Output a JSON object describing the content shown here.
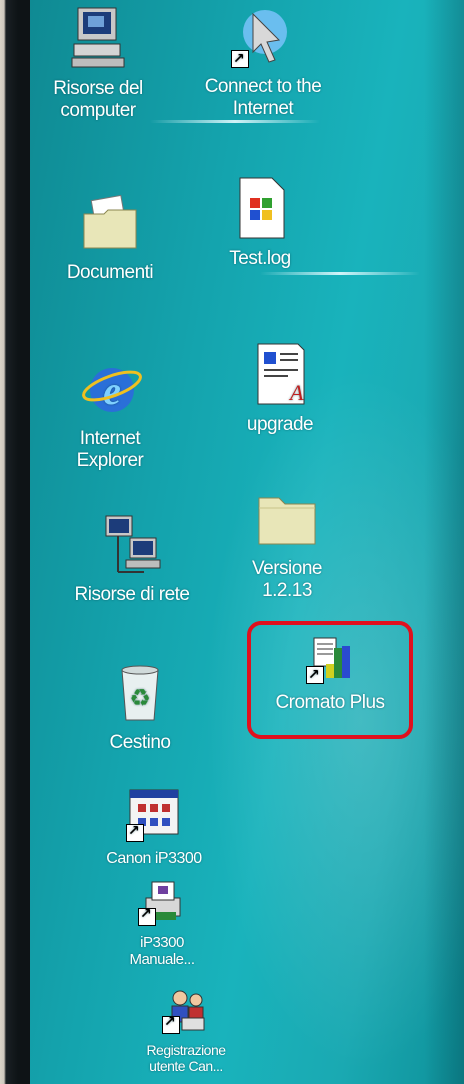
{
  "desktop": {
    "icons": [
      {
        "label": "Risorse del\ncomputer",
        "icon": "my-computer-icon"
      },
      {
        "label": "Connect to the\nInternet",
        "icon": "connect-internet-icon"
      },
      {
        "label": "Documenti",
        "icon": "folder-documents-icon"
      },
      {
        "label": "Test.log",
        "icon": "text-file-icon"
      },
      {
        "label": "Internet\nExplorer",
        "icon": "internet-explorer-icon"
      },
      {
        "label": "upgrade",
        "icon": "wordpad-document-icon"
      },
      {
        "label": "Risorse di rete",
        "icon": "network-icon"
      },
      {
        "label": "Versione\n1.2.13",
        "icon": "folder-icon"
      },
      {
        "label": "Cromato Plus",
        "icon": "cromato-plus-icon"
      },
      {
        "label": "Cestino",
        "icon": "recycle-bin-icon"
      },
      {
        "label": "Canon iP3300",
        "icon": "canon-printer-icon"
      },
      {
        "label": "iP3300\nManuale...",
        "icon": "manual-icon"
      },
      {
        "label": "Registrazione\nutente Can...",
        "icon": "registration-icon"
      }
    ]
  },
  "colors": {
    "desktop_teal": "#14a3ad",
    "highlight_red": "#e0101e"
  }
}
